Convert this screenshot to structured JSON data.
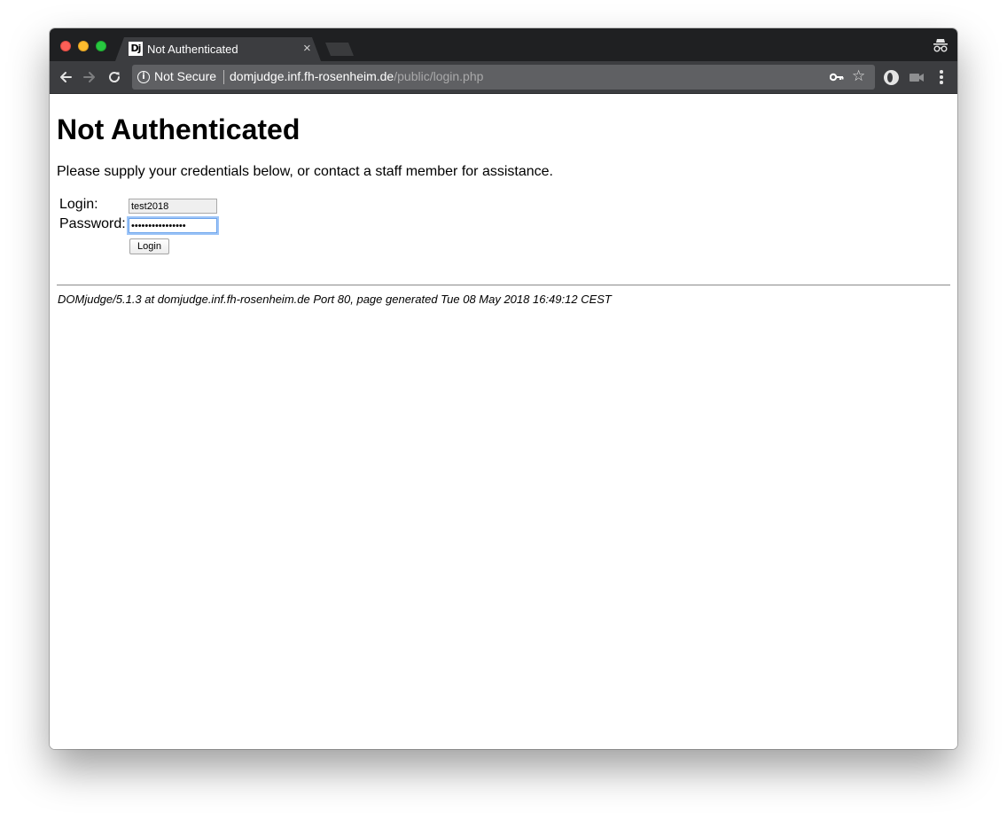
{
  "browser": {
    "tab_title": "Not Authenticated",
    "tab_close": "×",
    "favicon_text": "Dj",
    "security_text": "Not Secure",
    "url_host": "domjudge.inf.fh-rosenheim.de",
    "url_path": "/public/login.php",
    "icons": [
      "back-arrow-icon",
      "forward-arrow-icon",
      "reload-icon",
      "info-icon",
      "key-icon",
      "star-icon",
      "incognito-icon",
      "menu-icon"
    ],
    "colors": {
      "titlebar": "#1f2022",
      "toolbar": "#3c3d40",
      "omnibox": "#5f6063"
    }
  },
  "page": {
    "title": "Not Authenticated",
    "intro": "Please supply your credentials below, or contact a staff member for assistance.",
    "form": {
      "login_label": "Login:",
      "login_value": "test2018",
      "password_label": "Password:",
      "password_value": "••••••••••••••••",
      "submit_label": "Login"
    },
    "footer": "DOMjudge/5.1.3 at domjudge.inf.fh-rosenheim.de Port 80, page generated Tue 08 May 2018 16:49:12 CEST"
  }
}
